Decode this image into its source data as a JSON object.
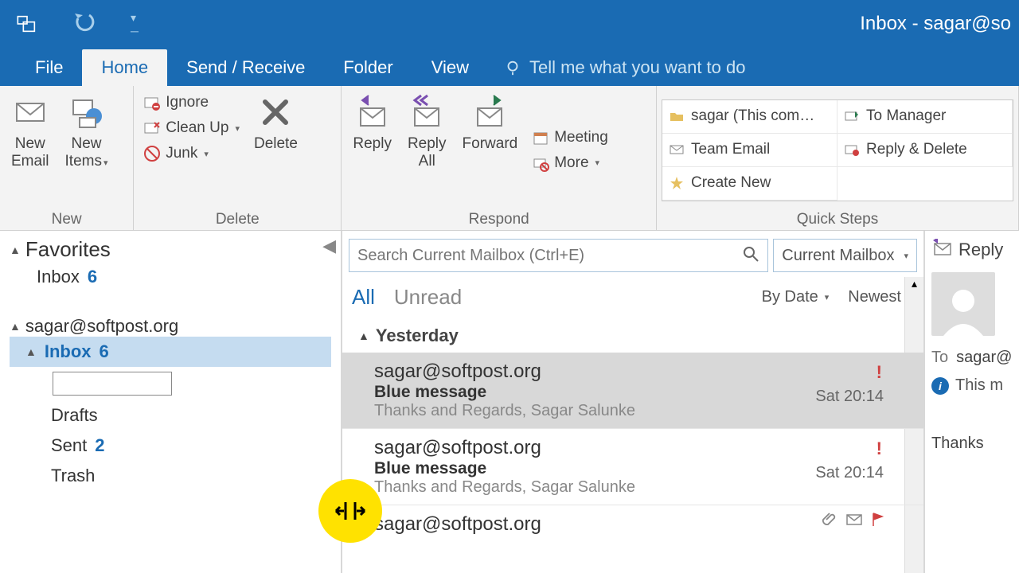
{
  "window": {
    "title": "Inbox - sagar@so"
  },
  "menu": {
    "file": "File",
    "home": "Home",
    "send_receive": "Send / Receive",
    "folder": "Folder",
    "view": "View",
    "tellme": "Tell me what you want to do"
  },
  "ribbon": {
    "new": {
      "label": "New",
      "new_email": "New\nEmail",
      "new_items": "New\nItems"
    },
    "delete": {
      "label": "Delete",
      "ignore": "Ignore",
      "cleanup": "Clean Up",
      "junk": "Junk",
      "delete": "Delete"
    },
    "respond": {
      "label": "Respond",
      "reply": "Reply",
      "reply_all": "Reply\nAll",
      "forward": "Forward",
      "meeting": "Meeting",
      "more": "More"
    },
    "quicksteps": {
      "label": "Quick Steps",
      "items": [
        "sagar (This com…",
        "To Manager",
        "Team Email",
        "Reply & Delete",
        "Create New"
      ]
    }
  },
  "nav": {
    "favorites": "Favorites",
    "inbox": "Inbox",
    "inbox_count": "6",
    "account": "sagar@softpost.org",
    "drafts": "Drafts",
    "sent": "Sent",
    "sent_count": "2",
    "trash": "Trash",
    "rename_value": ""
  },
  "search": {
    "placeholder": "Search Current Mailbox (Ctrl+E)",
    "scope": "Current Mailbox"
  },
  "filter": {
    "all": "All",
    "unread": "Unread",
    "by": "By Date",
    "order": "Newest"
  },
  "group": {
    "yesterday": "Yesterday"
  },
  "messages": [
    {
      "from": "sagar@softpost.org",
      "subject": "Blue message",
      "preview": "Thanks and Regards,  Sagar Salunke",
      "time": "Sat 20:14",
      "important": true
    },
    {
      "from": "sagar@softpost.org",
      "subject": "Blue message",
      "preview": "Thanks and Regards,  Sagar Salunke",
      "time": "Sat 20:14",
      "important": true
    },
    {
      "from": "sagar@softpost.org",
      "subject": "",
      "preview": "",
      "time": "",
      "important": false,
      "attach": true,
      "flag": true
    }
  ],
  "reading": {
    "reply": "Reply",
    "to_label": "To",
    "to_value": "sagar@",
    "info": "This m",
    "body": "Thanks"
  }
}
